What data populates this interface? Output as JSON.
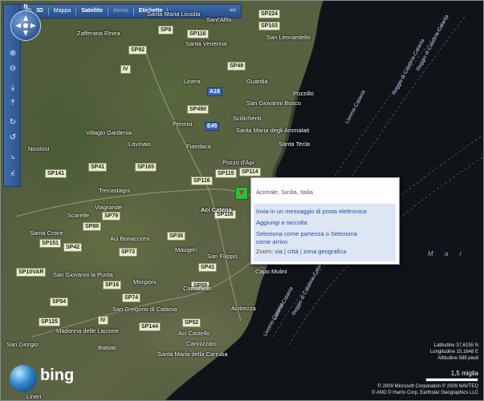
{
  "topbar": {
    "view_2d": "2D",
    "view_3d": "3D",
    "mappa": "Mappa",
    "satellite": "Satellite",
    "aerea": "Aerea",
    "etichette": "Etichette",
    "collapse": "<<"
  },
  "compass": {
    "north": "N"
  },
  "toolbar_icons": [
    "zoom-in-icon",
    "zoom-out-icon",
    "tilt-down-icon",
    "tilt-up-icon",
    "rotate-right-icon",
    "rotate-left-icon",
    "rotate-up-icon",
    "rotate-down-icon"
  ],
  "roads": {
    "sp224": "SP224",
    "sp103": "SP103",
    "sp116_a": "SP116",
    "sp116_b": "SP116",
    "sp116_c": "SP116",
    "iv_a": "IV",
    "iv_b": "IV",
    "sp92": "SP92",
    "sp8": "SP8",
    "sp49": "SP49",
    "sp49ii": "SP49II",
    "sp41": "SP41",
    "sp141": "SP141",
    "sp165": "SP165",
    "sp115": "SP115",
    "sp114": "SP114",
    "sp79": "SP79",
    "sp8ii": "SP8II",
    "sp151": "SP151",
    "sp42": "SP42",
    "sp73": "SP73",
    "sp3ii": "SP3II",
    "sp41b": "SP41",
    "sp10var": "SP10VAR",
    "sp16": "SP16",
    "sp74": "SP74",
    "sp54": "SP54",
    "sp125": "SP125",
    "sp144": "SP144",
    "sp52": "SP52",
    "sp55": "SP55",
    "a18": "A18",
    "e45": "E45"
  },
  "places": {
    "zafferana": "Zafferana Etnea",
    "santa_maria_licodia": "Santa Maria Licodia",
    "sant_alfio": "Sant'Alfio",
    "santa_venerina": "Santa Venerina",
    "san_leonardello": "San Leonardello",
    "linera": "Linera",
    "guardia": "Guardia",
    "pozzillo": "Pozzillo",
    "san_giovanni_bosco": "San Giovanni Bosco",
    "scillichenti": "Scillichenti",
    "smda": "Santa Maria degli Ammalati",
    "santa_tecla": "Santa Tecla",
    "pennisi": "Pennisi",
    "fiandaca": "Fiandaca",
    "pozzo_apio": "Pozzo d'Api",
    "villagio_gardenia": "Villagio Gardenia",
    "lavinaio": "Lavinaio",
    "nicolosi": "Nicolosi",
    "aci_catena": "Aci Catena",
    "trecastagni": "Trecastagni",
    "viagrande": "Viagrande",
    "scarelle": "Scarelle",
    "aci_bonaccorsi": "Aci Bonaccorsi",
    "santa_croce": "Santa Croce",
    "san_filippo": "San Filippo",
    "maugeri": "Maugeri",
    "capo_mulini": "Capo Mulini",
    "san_giovanni_punta": "San Giovanni la Punta",
    "morgioni": "Morgioni",
    "carminello": "Carminello",
    "acitrezza": "Acitrezza",
    "san_gregorio": "San Gregorio di Catania",
    "aci_castello": "Aci Castello",
    "cannizzaro": "Cannizzaro",
    "santa_maria_carruba": "Santa Maria della Carruba",
    "lineri": "Lineri",
    "madonna_delle_lacrime": "Madonna delle Lacrime",
    "battiati": "Battiati",
    "san_giorgio": "San Giorgio",
    "mar": "M a r"
  },
  "coast_labels": {
    "livorno_catania_1": "Livorno-Catania",
    "reggio_calabria_1": "Reggio di Calabria-Catania",
    "livorno_catania_2": "Livorno-Catania",
    "reggio_calabria_2": "Reggio di Calabria-Catania",
    "livorno_catania_3": "Livorno-Catania",
    "reggio_calabria_3": "Reggio di Calabria-Catania"
  },
  "popup": {
    "title": "Acireale, Sicilia, Italia",
    "send_email": "Invia in un messaggio di posta elettronica",
    "add_collection": "Aggiungi a raccolta",
    "select_start": "Seleziona come partenza",
    "or_text": "o",
    "select_end_a": "Seleziona",
    "select_end_b": "come arrivo",
    "zoom_label": "Zoom:",
    "zoom_via": "via",
    "zoom_citta": "città",
    "zoom_zona": "zona geografica",
    "sep": "|"
  },
  "coords": {
    "latitude": "Latitudine 37,6155 N",
    "longitude": "Longitudine 15,1648 E",
    "altitude": "Altitudine 589 piedi"
  },
  "scale": {
    "label": "1,5 miglia"
  },
  "copyright": {
    "line1": "© 2009 Microsoft Corporation  © 2009 NAVTEQ",
    "line2": "© AND  © Harris Corp, Earthstar Geographics LLC"
  },
  "logo": {
    "text": "bing"
  },
  "colors": {
    "toolbar": "#2f5a96",
    "link": "#1f4fa5",
    "sea": "#0e1418"
  }
}
